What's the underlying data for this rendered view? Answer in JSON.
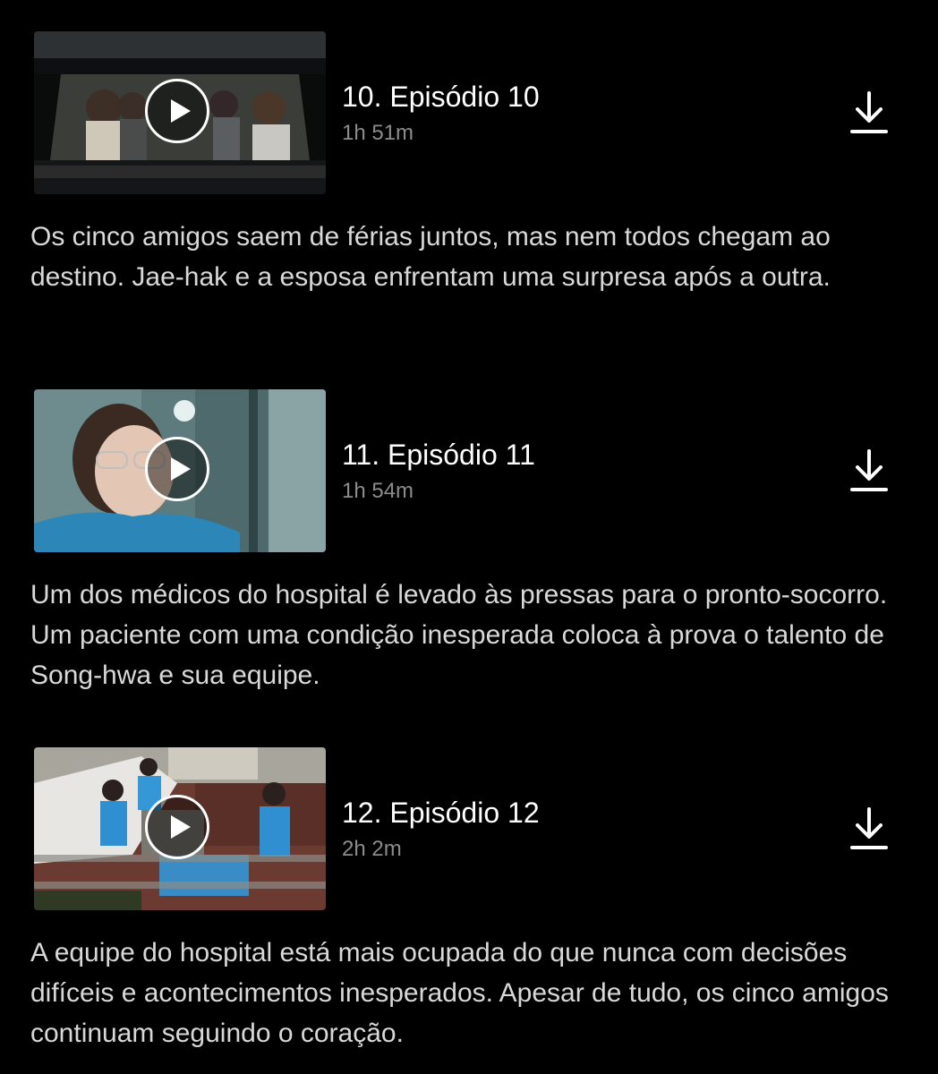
{
  "episodes": [
    {
      "title": "10. Episódio 10",
      "duration": "1h 51m",
      "synopsis": "Os cinco amigos saem de férias juntos, mas nem todos chegam ao destino. Jae-hak e a esposa enfrentam uma surpresa após a outra.",
      "thumbnail": "car-scene",
      "play_icon": "play-icon",
      "download_icon": "download-icon"
    },
    {
      "title": "11. Episódio 11",
      "duration": "1h 54m",
      "synopsis": "Um dos médicos do hospital é levado às pressas para o pronto-socorro. Um paciente com uma condição inesperada coloca à prova o talento de Song-hwa e sua equipe.",
      "thumbnail": "doctor-scene",
      "play_icon": "play-icon",
      "download_icon": "download-icon"
    },
    {
      "title": "12. Episódio 12",
      "duration": "2h 2m",
      "synopsis": "A equipe do hospital está mais ocupada do que nunca com decisões difíceis e acontecimentos inesperados. Apesar de tudo, os cinco amigos continuam seguindo o coração.",
      "thumbnail": "living-room-scene",
      "play_icon": "play-icon",
      "download_icon": "download-icon"
    }
  ],
  "colors": {
    "background": "#000000",
    "title": "#ffffff",
    "duration": "#8c8c8c",
    "synopsis": "#d8d8d8"
  }
}
